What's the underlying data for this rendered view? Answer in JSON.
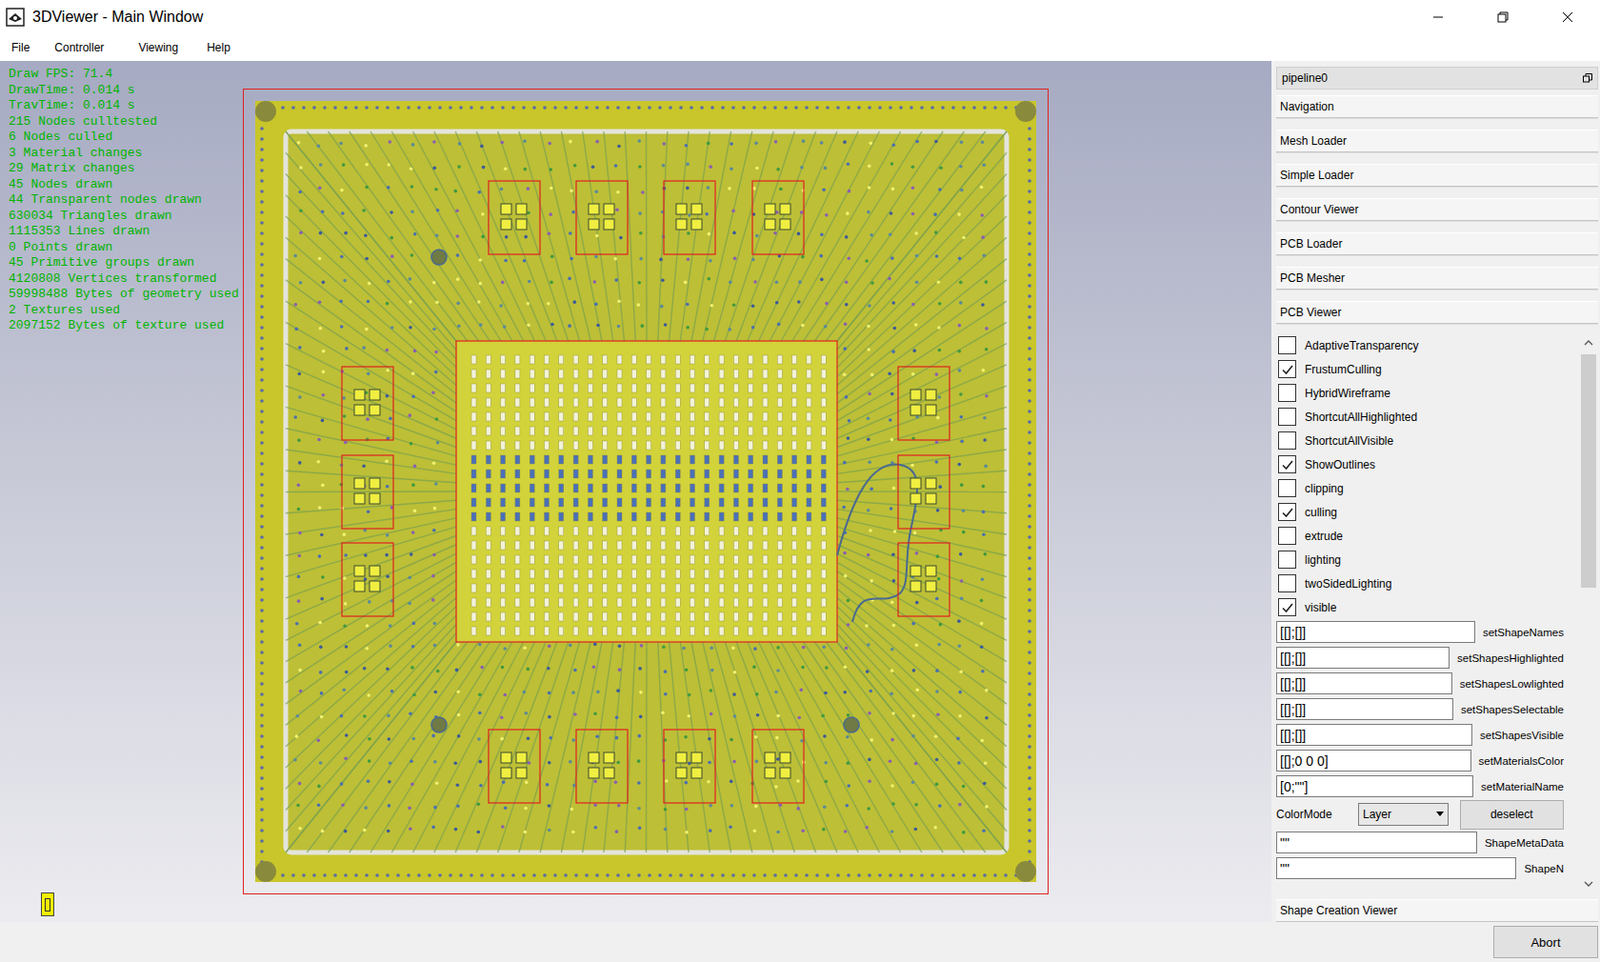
{
  "window": {
    "title": "3DViewer - Main Window"
  },
  "menu": [
    "File",
    "Controller",
    "Viewing",
    "Help"
  ],
  "stats": [
    "Draw FPS: 71.4",
    "DrawTime: 0.014 s",
    "TravTime: 0.014 s",
    "215 Nodes culltested",
    "6 Nodes culled",
    "3 Material changes",
    "29 Matrix changes",
    "45 Nodes drawn",
    "44 Transparent nodes drawn",
    "630034 Triangles drawn",
    "1115353 Lines drawn",
    "0 Points drawn",
    "45 Primitive groups drawn",
    "4120808 Vertices transformed",
    "59998488 Bytes of geometry used",
    "2 Textures used",
    "2097152 Bytes of texture used"
  ],
  "panel": {
    "header": "pipeline0",
    "sections": [
      "Navigation",
      "Mesh Loader",
      "Simple Loader",
      "Contour Viewer",
      "PCB Loader",
      "PCB Mesher",
      "PCB Viewer"
    ],
    "checkboxes": [
      {
        "label": "AdaptiveTransparency",
        "checked": false
      },
      {
        "label": "FrustumCulling",
        "checked": true
      },
      {
        "label": "HybridWireframe",
        "checked": false
      },
      {
        "label": "ShortcutAllHighlighted",
        "checked": false
      },
      {
        "label": "ShortcutAllVisible",
        "checked": false
      },
      {
        "label": "ShowOutlines",
        "checked": true
      },
      {
        "label": "clipping",
        "checked": false
      },
      {
        "label": "culling",
        "checked": true
      },
      {
        "label": "extrude",
        "checked": false
      },
      {
        "label": "lighting",
        "checked": false
      },
      {
        "label": "twoSidedLighting",
        "checked": false
      },
      {
        "label": "visible",
        "checked": true
      }
    ],
    "fields": [
      {
        "value": "[[];[]]",
        "label": "setShapeNames"
      },
      {
        "value": "[[];[]]",
        "label": "setShapesHighlighted"
      },
      {
        "value": "[[];[]]",
        "label": "setShapesLowlighted"
      },
      {
        "value": "[[];[]]",
        "label": "setShapesSelectable"
      },
      {
        "value": "[[];[]]",
        "label": "setShapesVisible"
      },
      {
        "value": "[[];0 0 0]",
        "label": "setMaterialsColor"
      },
      {
        "value": "[0;\"\"]",
        "label": "setMaterialName"
      }
    ],
    "color_mode": {
      "label": "ColorMode",
      "value": "Layer"
    },
    "deselect": "deselect",
    "meta_fields": [
      {
        "value": "\"\"",
        "label": "ShapeMetaData"
      },
      {
        "value": "\"\"",
        "label": "ShapeN"
      }
    ],
    "scrollbar": {
      "level": 0.45
    },
    "footer_section": "Shape Creation Viewer"
  },
  "status_bar": {
    "button": "Abort"
  }
}
